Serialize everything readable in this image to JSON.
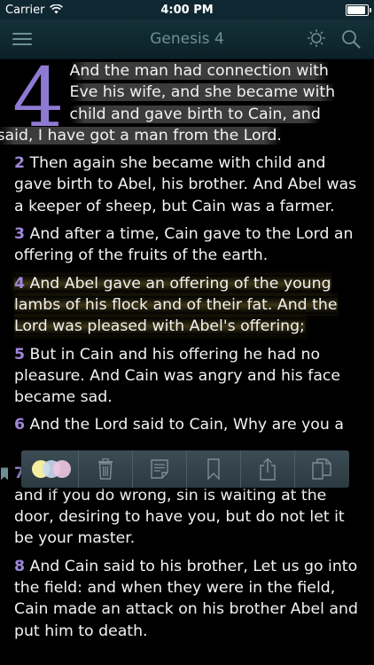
{
  "status_bar": {
    "carrier": "Carrier",
    "time": "4:00 PM",
    "battery_level": 0.9
  },
  "nav": {
    "title": "Genesis 4"
  },
  "verses": {
    "v1": {
      "dropcap": "4",
      "lines": [
        "And the man had connection with",
        "Eve his wife, and she became with",
        "child and gave birth to Cain, and",
        "said, I have got a man from the Lord."
      ]
    },
    "v2": {
      "num": "2",
      "text": "Then again she became with child and gave birth to Abel, his brother. And Abel was a keeper of sheep, but Cain was a farmer."
    },
    "v3": {
      "num": "3",
      "text": "And after a time, Cain gave to the Lord an offering of the fruits of the earth."
    },
    "v4": {
      "num": "4",
      "text": "And Abel gave an offering of the young lambs of his flock and of their fat. And the Lord was pleased with Abel's offering;"
    },
    "v5": {
      "num": "5",
      "text": "But in Cain and his offering he had no pleasure. And Cain was angry and his face became sad."
    },
    "v6": {
      "num": "6",
      "text": "And the Lord said to Cain, Why are you a"
    },
    "v7": {
      "num": "7",
      "text": "If you do well, will you not have honour? and if you do wrong, sin is waiting at the door, desiring to have you, but do not let it be your master."
    },
    "v8": {
      "num": "8",
      "text": "And Cain said to his brother, Let us go into the field: and when they were in the field, Cain made an attack on his brother Abel and put him to death."
    }
  },
  "colors": {
    "verse_number": "#9f88d8",
    "nav_background": "#12282f",
    "highlight_gray": "#6e6e6e",
    "highlight_gold": "#6e5f28",
    "highlight_dot_yellow": "#f3eea0",
    "highlight_dot_blue": "#c8d8f0",
    "highlight_dot_pink": "#f0c8e0"
  },
  "icons": {
    "menu": "hamburger-menu-icon",
    "brightness": "sun-icon",
    "search": "magnifier-icon",
    "highlight": "color-dots-icon",
    "delete": "trash-icon",
    "note": "note-icon",
    "bookmark": "bookmark-icon",
    "share": "share-icon",
    "copy": "copy-icon"
  }
}
